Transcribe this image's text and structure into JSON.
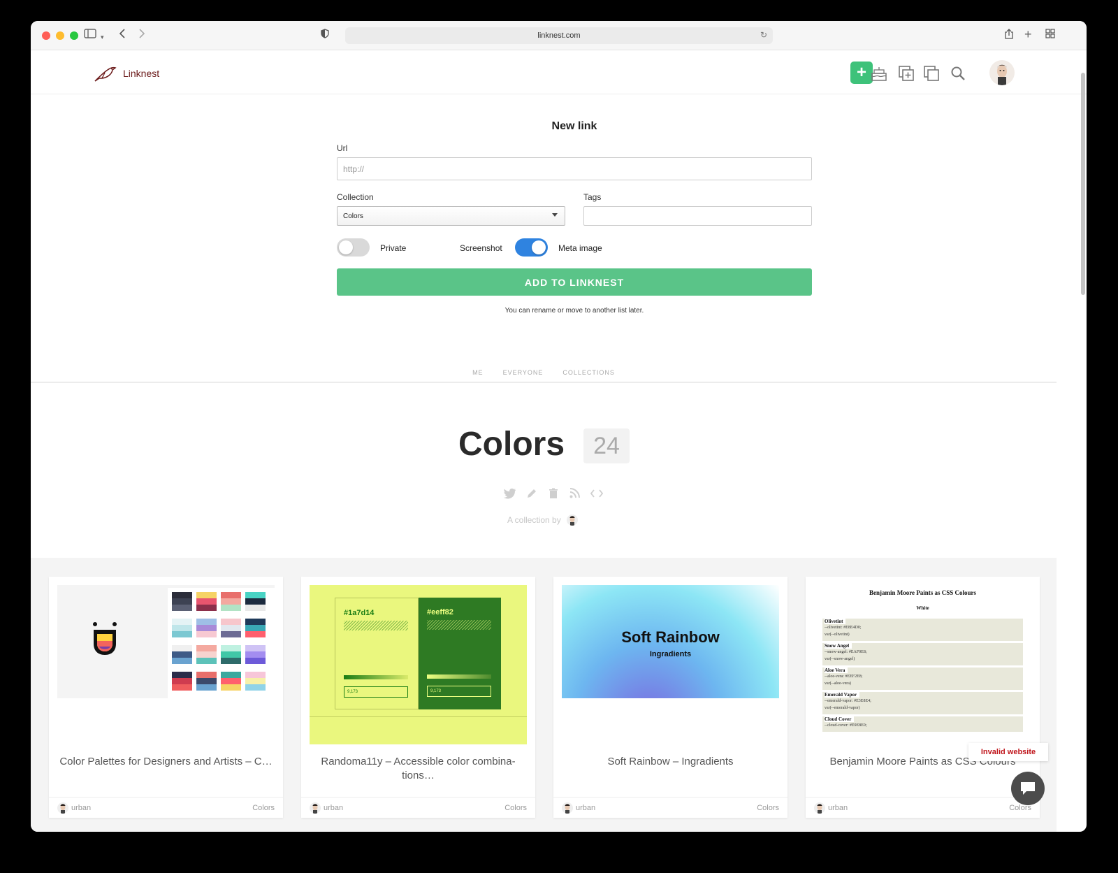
{
  "browser": {
    "url": "linknest.com"
  },
  "app": {
    "name": "Linknest"
  },
  "form": {
    "title": "New link",
    "url_label": "Url",
    "url_placeholder": "http://",
    "collection_label": "Collection",
    "collection_value": "Colors",
    "tags_label": "Tags",
    "private_label": "Private",
    "screenshot_label": "Screenshot",
    "meta_label": "Meta image",
    "private_on": false,
    "meta_on": true,
    "submit_label": "ADD TO LINKNEST",
    "hint": "You can rename or move to another list later."
  },
  "tabs": [
    "ME",
    "EVERYONE",
    "COLLECTIONS"
  ],
  "collection": {
    "title": "Colors",
    "count": "24",
    "by_text": "A collection by"
  },
  "cards": [
    {
      "title": "Color Palettes for Designers and Artists – C…",
      "user": "urban",
      "collection": "Colors"
    },
    {
      "title": "Randoma11y – Accessible color combina-tions…",
      "user": "urban",
      "collection": "Colors",
      "thumb": {
        "left_hex": "#1a7d14",
        "right_hex": "#eeff82",
        "left_num": "9,173",
        "right_num": "9,173"
      }
    },
    {
      "title": "Soft Rainbow – Ingradients",
      "user": "urban",
      "collection": "Colors",
      "thumb": {
        "heading": "Soft Rainbow",
        "sub": "Ingradients"
      }
    },
    {
      "title": "Benjamin Moore Paints as CSS Colours",
      "user": "urban",
      "collection": "Colors",
      "thumb": {
        "heading": "Benjamin Moore Paints as CSS Colours",
        "sub": "White",
        "rows": [
          {
            "name": "Olivetint",
            "l1": "--olivetint: #E8E4D0;",
            "l2": "var(--olivetint)"
          },
          {
            "name": "Snow Angel",
            "l1": "--snow-angel: #EAF0E8;",
            "l2": "var(--snow-angel)"
          },
          {
            "name": "Aloe Vera",
            "l1": "--aloe-vera: #EEF2E8;",
            "l2": "var(--aloe-vera)"
          },
          {
            "name": "Emerald Vapor",
            "l1": "--emerald-vapor: #E3E8E4;",
            "l2": "var(--emerald-vapor)"
          },
          {
            "name": "Cloud Cover",
            "l1": "--cloud-cover: #E9E8E0;",
            "l2": ""
          }
        ]
      }
    }
  ],
  "toast": "Invalid website",
  "colors": {
    "accent_green": "#3ec27a",
    "toggle_blue": "#2f83e0",
    "brand_red": "#6b1a1a"
  },
  "icons": [
    "sidebar-icon",
    "back-icon",
    "forward-icon",
    "shield-icon",
    "reload-icon",
    "share-icon",
    "new-tab-icon",
    "tabs-icon",
    "plus-icon",
    "cake-icon",
    "collection-add-icon",
    "collections-icon",
    "search-icon",
    "twitter-icon",
    "pencil-icon",
    "trash-icon",
    "rss-icon",
    "code-icon",
    "chat-icon"
  ]
}
